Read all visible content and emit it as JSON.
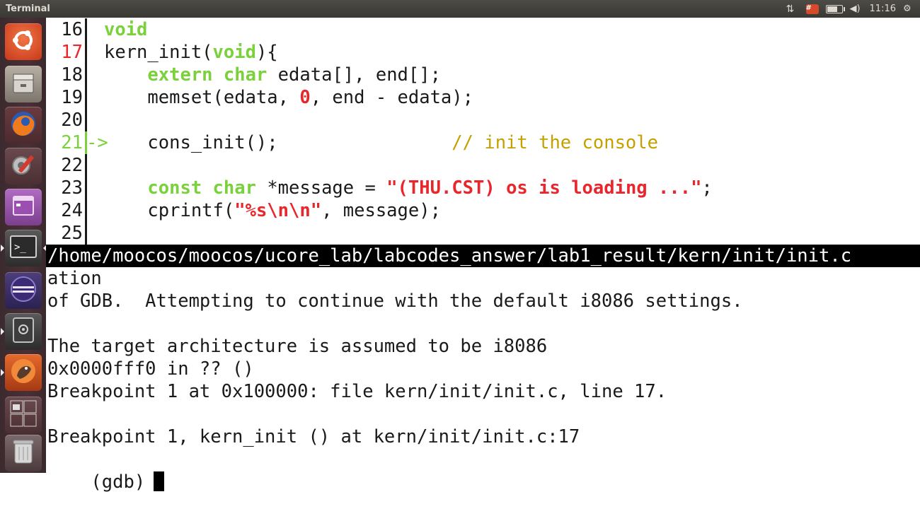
{
  "window": {
    "title": "Terminal"
  },
  "tray": {
    "keyboard_label": "#",
    "clock": "11:16"
  },
  "launcher": {
    "items": [
      {
        "name": "dash",
        "icon": "ubuntu-logo-icon"
      },
      {
        "name": "files",
        "icon": "file-cabinet-icon"
      },
      {
        "name": "firefox",
        "icon": "firefox-icon"
      },
      {
        "name": "system-settings",
        "icon": "gear-wrench-icon"
      },
      {
        "name": "workspace",
        "icon": "purple-window-icon"
      },
      {
        "name": "terminal",
        "icon": "terminal-icon"
      },
      {
        "name": "eclipse",
        "icon": "eclipse-icon"
      },
      {
        "name": "disk",
        "icon": "disk-drive-icon"
      },
      {
        "name": "gdb-frontend",
        "icon": "gnu-icon"
      },
      {
        "name": "workspaces",
        "icon": "workspace-switcher-icon"
      },
      {
        "name": "trash",
        "icon": "trash-icon"
      }
    ]
  },
  "source": {
    "lines": [
      {
        "num": "16",
        "tokens": [
          {
            "t": "void",
            "c": "kw"
          }
        ]
      },
      {
        "num": "17",
        "breakpoint": true,
        "tokens": [
          {
            "t": "kern_init(",
            "c": ""
          },
          {
            "t": "void",
            "c": "kw"
          },
          {
            "t": "){",
            "c": ""
          }
        ]
      },
      {
        "num": "18",
        "tokens": [
          {
            "t": "    ",
            "c": ""
          },
          {
            "t": "extern",
            "c": "kw"
          },
          {
            "t": " ",
            "c": ""
          },
          {
            "t": "char",
            "c": "kw"
          },
          {
            "t": " edata[], end[];",
            "c": ""
          }
        ]
      },
      {
        "num": "19",
        "tokens": [
          {
            "t": "    memset(edata, ",
            "c": ""
          },
          {
            "t": "0",
            "c": "num"
          },
          {
            "t": ", end - edata);",
            "c": ""
          }
        ]
      },
      {
        "num": "20",
        "tokens": []
      },
      {
        "num": "21",
        "current": true,
        "arrow": "->",
        "tokens": [
          {
            "t": "    cons_init();                ",
            "c": ""
          },
          {
            "t": "// init the console",
            "c": "cmt"
          }
        ]
      },
      {
        "num": "22",
        "tokens": []
      },
      {
        "num": "23",
        "tokens": [
          {
            "t": "    ",
            "c": ""
          },
          {
            "t": "const",
            "c": "kw"
          },
          {
            "t": " ",
            "c": ""
          },
          {
            "t": "char",
            "c": "kw"
          },
          {
            "t": " *message = ",
            "c": ""
          },
          {
            "t": "\"(THU.CST) os is loading ...\"",
            "c": "str"
          },
          {
            "t": ";",
            "c": ""
          }
        ]
      },
      {
        "num": "24",
        "tokens": [
          {
            "t": "    cprintf(",
            "c": ""
          },
          {
            "t": "\"%s\\n\\n\"",
            "c": "str"
          },
          {
            "t": ", message);",
            "c": ""
          }
        ]
      },
      {
        "num": "25",
        "tokens": []
      }
    ]
  },
  "path_bar": "/home/moocos/moocos/ucore_lab/labcodes_answer/lab1_result/kern/init/init.c",
  "gdb": {
    "lines": [
      "ation",
      "of GDB.  Attempting to continue with the default i8086 settings.",
      "",
      "The target architecture is assumed to be i8086",
      "0x0000fff0 in ?? ()",
      "Breakpoint 1 at 0x100000: file kern/init/init.c, line 17.",
      "",
      "Breakpoint 1, kern_init () at kern/init/init.c:17"
    ],
    "prompt": "(gdb)"
  }
}
